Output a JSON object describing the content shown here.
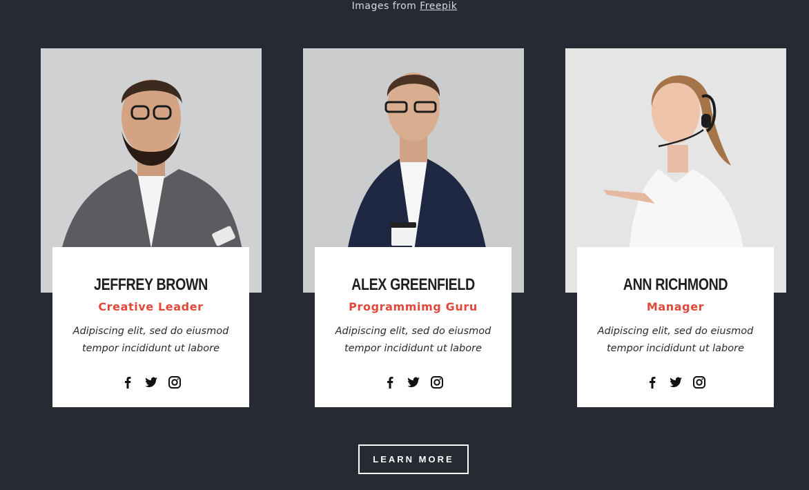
{
  "credit": {
    "prefix": "Images from",
    "link": "Freepik"
  },
  "members": [
    {
      "name": "Jeffrey Brown",
      "role": "Creative Leader",
      "desc": "Adipiscing elit, sed do eiusmod tempor incididunt ut labore"
    },
    {
      "name": "Alex Greenfield",
      "role": "Programmimg Guru",
      "desc": "Adipiscing elit, sed do eiusmod tempor incididunt ut labore"
    },
    {
      "name": "Ann Richmond",
      "role": "Manager",
      "desc": "Adipiscing elit, sed do eiusmod tempor incididunt ut labore"
    }
  ],
  "social_icons": [
    "facebook-icon",
    "twitter-icon",
    "instagram-icon"
  ],
  "cta": {
    "label": "Learn More"
  },
  "colors": {
    "background": "#272a33",
    "accent": "#e2473a",
    "card": "#ffffff"
  }
}
